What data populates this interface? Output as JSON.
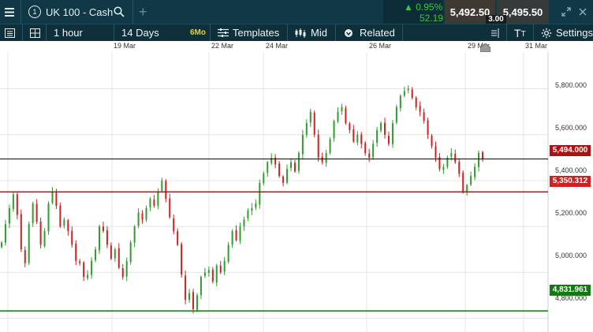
{
  "header": {
    "instrument": "UK 100 - Cash",
    "instrument_index": "1",
    "change_pct": "0.95%",
    "change_abs": "52.19",
    "sell_price": "5,492.50",
    "buy_price": "5,495.50",
    "spread": "3.00"
  },
  "toolbar": {
    "interval": "1 hour",
    "range": "14 Days",
    "range_badge": "6Mo",
    "templates": "Templates",
    "price_type": "Mid",
    "related": "Related",
    "settings": "Settings"
  },
  "colors": {
    "accent": "#103846",
    "up": "#2e9e2e",
    "down": "#cc2222",
    "current_line": "#000000",
    "resistance_line": "#cc0000",
    "support_line": "#137a13",
    "badge": "#e8d21a"
  },
  "chart_data": {
    "type": "candlestick",
    "x_labels": [
      "19 Mar",
      "22 Mar",
      "24 Mar",
      "26 Mar",
      "29 Mar",
      "31 Mar"
    ],
    "y_ticks": [
      "5,800.000",
      "5,600.000",
      "5,400.000",
      "5,200.000",
      "5,000.000",
      "4,800.000"
    ],
    "ylim": [
      4740,
      5960
    ],
    "horizontal_lines": [
      {
        "label": "5,494.000",
        "value": 5494
      },
      {
        "label": "5,350.312",
        "value": 5350.312
      },
      {
        "label": "4,831.961",
        "value": 4831.961
      }
    ],
    "closes": [
      5130,
      5210,
      5280,
      5340,
      5250,
      5100,
      5040,
      5210,
      5300,
      5220,
      5120,
      5180,
      5300,
      5350,
      5290,
      5200,
      5230,
      5180,
      5120,
      5050,
      5040,
      4980,
      4990,
      5050,
      5100,
      5200,
      5180,
      5120,
      5060,
      5100,
      5020,
      4980,
      5050,
      5130,
      5200,
      5260,
      5230,
      5280,
      5320,
      5290,
      5350,
      5400,
      5320,
      5240,
      5180,
      5120,
      4990,
      4880,
      4910,
      4840,
      4900,
      4980,
      5000,
      5010,
      4960,
      5030,
      5000,
      5050,
      5120,
      5180,
      5140,
      5200,
      5230,
      5270,
      5280,
      5300,
      5390,
      5430,
      5480,
      5500,
      5470,
      5420,
      5390,
      5450,
      5480,
      5440,
      5520,
      5600,
      5650,
      5700,
      5600,
      5500,
      5480,
      5520,
      5580,
      5660,
      5700,
      5720,
      5650,
      5620,
      5570,
      5600,
      5560,
      5520,
      5500,
      5560,
      5620,
      5650,
      5600,
      5560,
      5650,
      5720,
      5770,
      5790,
      5800,
      5760,
      5720,
      5700,
      5660,
      5600,
      5550,
      5500,
      5450,
      5460,
      5500,
      5520,
      5480,
      5430,
      5350,
      5380,
      5420,
      5460,
      5520,
      5494
    ]
  }
}
